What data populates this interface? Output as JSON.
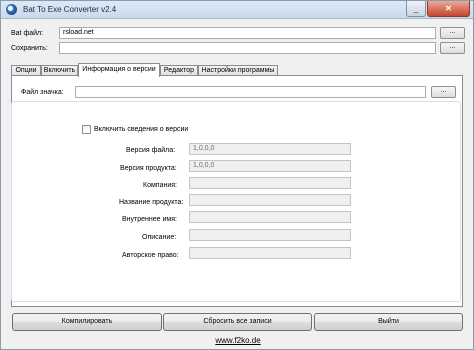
{
  "window": {
    "title": "Bat To Exe Converter v2.4"
  },
  "bat_file": {
    "label": "Bat файл:",
    "value": "rsload.net",
    "browse": "..."
  },
  "save": {
    "label": "Сохранить:",
    "value": "",
    "browse": "..."
  },
  "tabs": [
    "Опции",
    "Включить",
    "Информация о версии",
    "Редактор",
    "Настройки программы"
  ],
  "icon_file": {
    "label": "Файл значка:",
    "value": "",
    "browse": "..."
  },
  "version_info": {
    "enable_label": "Включить сведения о версии",
    "fields": [
      {
        "label": "Версия файла:",
        "value": "1,0,0,0"
      },
      {
        "label": "Версия продукта:",
        "value": "1,0,0,0"
      },
      {
        "label": "Компания:",
        "value": ""
      },
      {
        "label": "Название продукта:",
        "value": ""
      },
      {
        "label": "Внутреннее имя:",
        "value": ""
      },
      {
        "label": "Описание:",
        "value": ""
      },
      {
        "label": "Авторское право:",
        "value": ""
      }
    ]
  },
  "buttons": {
    "compile": "Компилировать",
    "reset": "Сбросить все записи",
    "exit": "Выйти"
  },
  "footer_link": "www.f2ko.de"
}
